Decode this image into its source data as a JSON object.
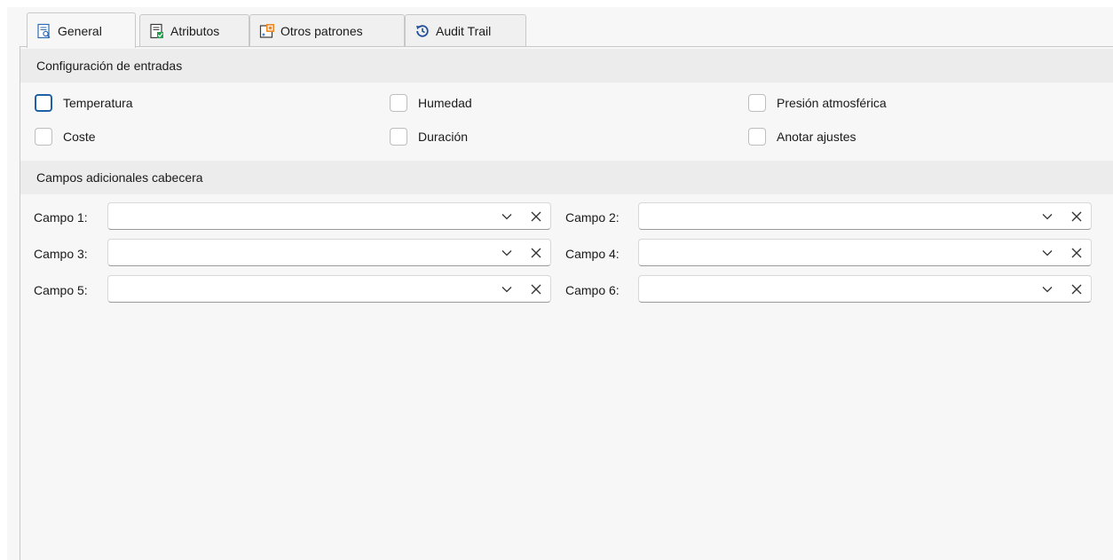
{
  "tabs": [
    {
      "label": "General",
      "icon": "report-search-icon",
      "active": true
    },
    {
      "label": "Atributos",
      "icon": "attributes-list-icon",
      "active": false
    },
    {
      "label": "Otros patrones",
      "icon": "patterns-icon",
      "active": false
    },
    {
      "label": "Audit Trail",
      "icon": "history-icon",
      "active": false
    }
  ],
  "config": {
    "title": "Configuración de entradas",
    "items": [
      {
        "label": "Temperatura",
        "checked": false,
        "focused": true
      },
      {
        "label": "Humedad",
        "checked": false
      },
      {
        "label": "Presión atmosférica",
        "checked": false
      },
      {
        "label": "Coste",
        "checked": false
      },
      {
        "label": "Duración",
        "checked": false
      },
      {
        "label": "Anotar ajustes",
        "checked": false
      }
    ]
  },
  "fields": {
    "title": "Campos adicionales cabecera",
    "items": [
      {
        "label": "Campo 1:",
        "value": ""
      },
      {
        "label": "Campo 2:",
        "value": ""
      },
      {
        "label": "Campo 3:",
        "value": ""
      },
      {
        "label": "Campo 4:",
        "value": ""
      },
      {
        "label": "Campo 5:",
        "value": ""
      },
      {
        "label": "Campo 6:",
        "value": ""
      }
    ]
  },
  "colors": {
    "focus": "#1f5fa6",
    "header_bg": "#ececec",
    "panel_bg": "#f7f7f7"
  }
}
